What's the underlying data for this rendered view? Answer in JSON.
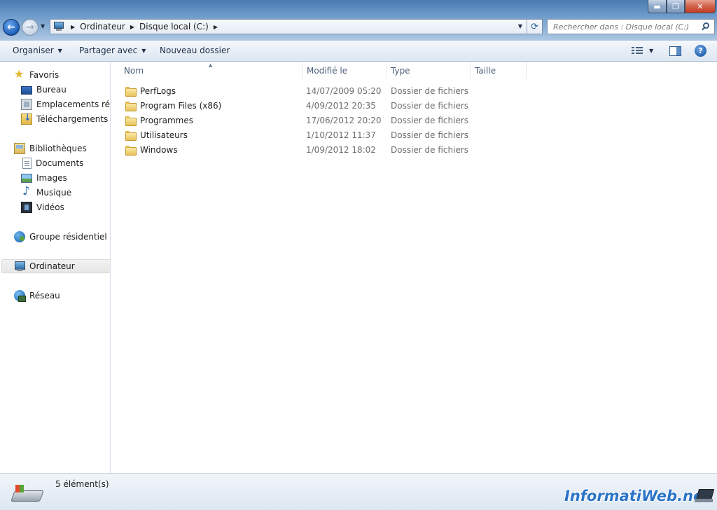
{
  "window": {
    "controls": {
      "minimize": "▬",
      "maximize": "❐",
      "close": "✕"
    }
  },
  "navigation": {
    "back_icon": "back-arrow-icon",
    "forward_icon": "forward-arrow-icon"
  },
  "address_bar": {
    "crumbs": [
      "Ordinateur",
      "Disque local (C:)"
    ],
    "separator": "▶"
  },
  "search": {
    "placeholder": "Rechercher dans : Disque local (C:)"
  },
  "toolbar": {
    "organize_label": "Organiser",
    "share_label": "Partager avec",
    "new_folder_label": "Nouveau dossier"
  },
  "sidebar": {
    "favorites_label": "Favoris",
    "favorites": [
      {
        "label": "Bureau"
      },
      {
        "label": "Emplacements récents"
      },
      {
        "label": "Téléchargements"
      }
    ],
    "libraries_label": "Bibliothèques",
    "libraries": [
      {
        "label": "Documents"
      },
      {
        "label": "Images"
      },
      {
        "label": "Musique"
      },
      {
        "label": "Vidéos"
      }
    ],
    "homegroup_label": "Groupe résidentiel",
    "computer_label": "Ordinateur",
    "network_label": "Réseau"
  },
  "file_list": {
    "columns": [
      "Nom",
      "Modifié le",
      "Type",
      "Taille"
    ],
    "rows": [
      {
        "name": "PerfLogs",
        "modified": "14/07/2009 05:20",
        "type": "Dossier de fichiers",
        "size": ""
      },
      {
        "name": "Program Files (x86)",
        "modified": "4/09/2012 20:35",
        "type": "Dossier de fichiers",
        "size": ""
      },
      {
        "name": "Programmes",
        "modified": "17/06/2012 20:20",
        "type": "Dossier de fichiers",
        "size": ""
      },
      {
        "name": "Utilisateurs",
        "modified": "1/10/2012 11:37",
        "type": "Dossier de fichiers",
        "size": ""
      },
      {
        "name": "Windows",
        "modified": "1/09/2012 18:02",
        "type": "Dossier de fichiers",
        "size": ""
      }
    ]
  },
  "status": {
    "item_count": "5 élément(s)"
  },
  "watermark": {
    "text": "InformatiWeb.net"
  },
  "colors": {
    "accent": "#2b74c8",
    "titlebar": "#6f9ccb"
  }
}
